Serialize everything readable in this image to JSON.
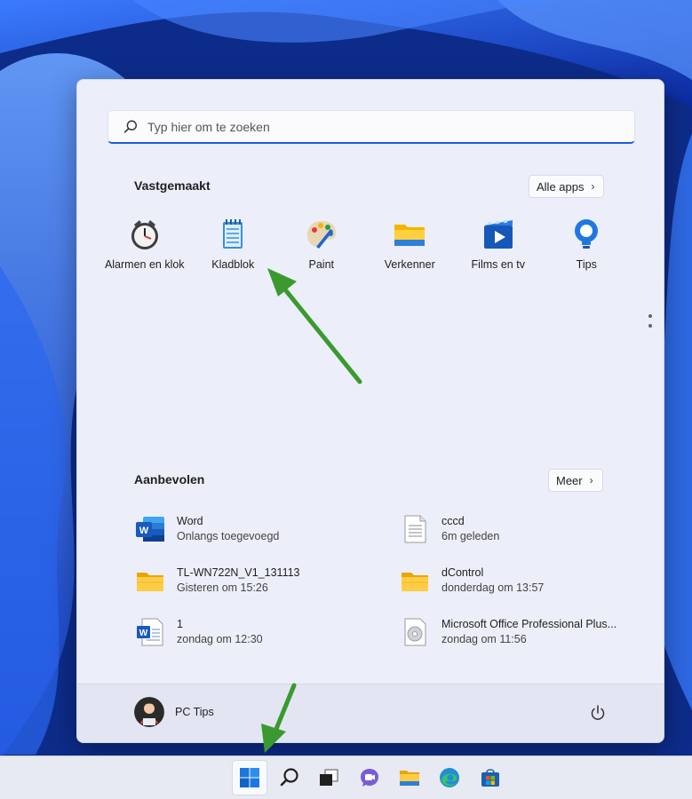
{
  "search": {
    "placeholder": "Typ hier om te zoeken"
  },
  "pinned": {
    "title": "Vastgemaakt",
    "all_apps_label": "Alle apps",
    "items": [
      {
        "label": "Alarmen en klok",
        "icon": "alarm-clock-icon"
      },
      {
        "label": "Kladblok",
        "icon": "notepad-icon"
      },
      {
        "label": "Paint",
        "icon": "paint-palette-icon"
      },
      {
        "label": "Verkenner",
        "icon": "file-explorer-folder-icon"
      },
      {
        "label": "Films en tv",
        "icon": "films-tv-icon"
      },
      {
        "label": "Tips",
        "icon": "tips-lightbulb-icon"
      }
    ]
  },
  "recommended": {
    "title": "Aanbevolen",
    "more_label": "Meer",
    "items": [
      {
        "name": "Word",
        "sub": "Onlangs toegevoegd",
        "icon": "word-app-icon"
      },
      {
        "name": "cccd",
        "sub": "6m geleden",
        "icon": "text-file-icon"
      },
      {
        "name": "TL-WN722N_V1_131113",
        "sub": "Gisteren om 15:26",
        "icon": "folder-icon"
      },
      {
        "name": "dControl",
        "sub": "donderdag om 13:57",
        "icon": "folder-icon"
      },
      {
        "name": "1",
        "sub": "zondag om 12:30",
        "icon": "word-document-icon"
      },
      {
        "name": "Microsoft Office Professional Plus...",
        "sub": "zondag om 11:56",
        "icon": "disc-image-file-icon"
      }
    ]
  },
  "user": {
    "name": "PC Tips"
  },
  "taskbar": {
    "items": [
      "start-icon",
      "search-icon",
      "task-view-icon",
      "teams-chat-icon",
      "file-explorer-icon",
      "edge-browser-icon",
      "microsoft-store-icon"
    ]
  },
  "colors": {
    "accent": "#1d5bd6",
    "annotation_arrow": "#3a9a2f",
    "start_menu_bg": "#eceff9"
  }
}
